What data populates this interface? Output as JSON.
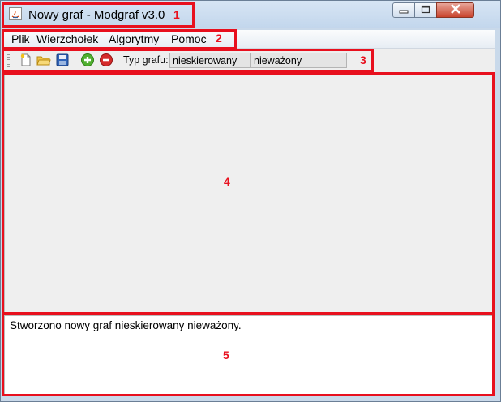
{
  "window": {
    "title": "Nowy graf - Modgraf v3.0",
    "controls": [
      "minimize-icon",
      "maximize-icon",
      "close-icon"
    ]
  },
  "menu": {
    "items": [
      {
        "label": "Plik"
      },
      {
        "label": "Wierzchołek"
      },
      {
        "label": "Algorytmy"
      },
      {
        "label": "Pomoc"
      }
    ]
  },
  "toolbar": {
    "icons": [
      "new-file-icon",
      "open-folder-icon",
      "save-icon",
      "add-vertex-icon",
      "remove-vertex-icon"
    ],
    "type_label": "Typ grafu:",
    "graph_direction": "nieskierowany",
    "graph_weight": "nieważony"
  },
  "console": {
    "message": "Stworzono nowy graf nieskierowany nieważony."
  },
  "annotations": {
    "labels": [
      "1",
      "2",
      "3",
      "4",
      "5"
    ],
    "color": "#e8101e"
  },
  "colors": {
    "titlebar": "#c9d9ea",
    "close": "#c9442d",
    "canvas": "#efefef"
  }
}
